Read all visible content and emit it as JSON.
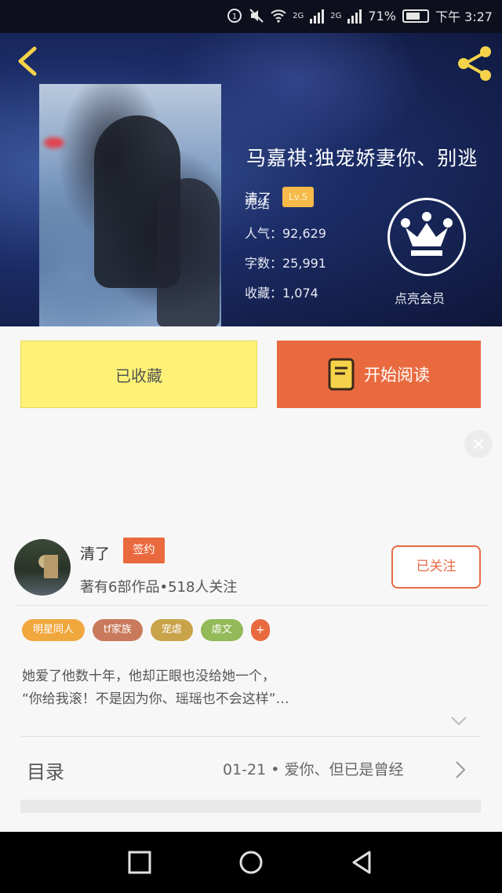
{
  "status_bar": {
    "network_labels": [
      "2G",
      "2G"
    ],
    "battery": "71%",
    "time": "下午 3:27"
  },
  "book": {
    "title": "马嘉祺:独宠娇妻你、别逃",
    "author": "清了",
    "level": "Lv.5",
    "status": "完结",
    "popularity": "人气：92,629",
    "word_count": "字数：25,991",
    "favorites": "收藏：1,074"
  },
  "membership": {
    "label": "点亮会员"
  },
  "actions": {
    "favorited_label": "已收藏",
    "read_label": "开始阅读"
  },
  "author_card": {
    "name": "清了",
    "badge": "签约",
    "works_summary": "著有6部作品•518人关注",
    "follow_label": "已关注"
  },
  "tags": [
    {
      "label": "明星同人",
      "color": "#f0a73e"
    },
    {
      "label": "tf家族",
      "color": "#c97a5c"
    },
    {
      "label": "宠虐",
      "color": "#c9a34a"
    },
    {
      "label": "虐文",
      "color": "#93ba59"
    },
    {
      "label": "+",
      "color": "#ea6a3f"
    }
  ],
  "description": {
    "line1": "她爱了他数十年，他却正眼也没给她一个，",
    "line2": "“你给我滚！不是因为你、瑶瑶也不会这样”…"
  },
  "toc": {
    "label": "目录",
    "latest": "01-21 • 爱你、但已是曾经"
  },
  "icons": {
    "back": "chevron-left-icon",
    "share": "share-icon",
    "crown": "crown-icon",
    "book": "book-icon"
  },
  "colors": {
    "accent": "#ea6a3f",
    "favorite_button": "#fdf276",
    "gold_icon": "#f5d24a"
  }
}
